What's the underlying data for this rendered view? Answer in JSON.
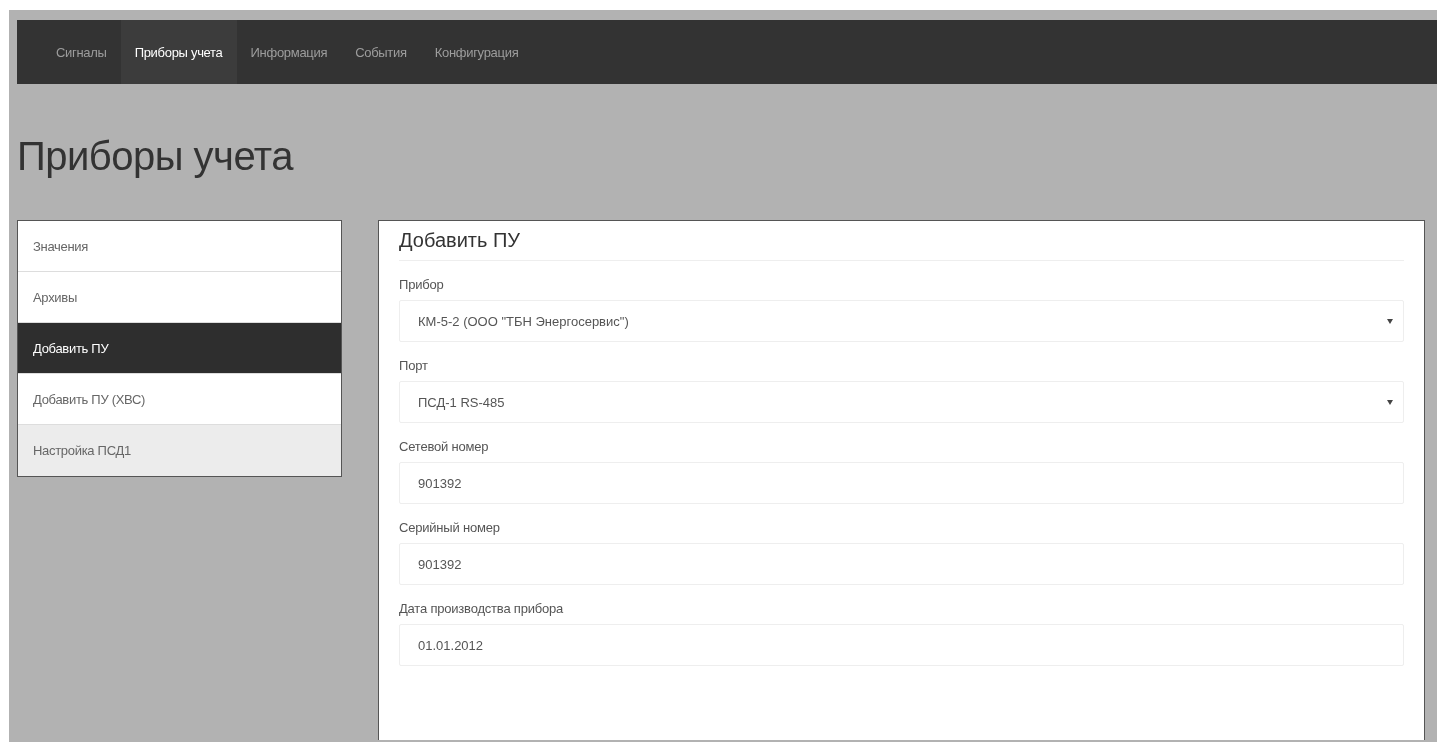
{
  "navbar": {
    "items": [
      {
        "label": "Сигналы",
        "selected": false
      },
      {
        "label": "Приборы учета",
        "selected": true
      },
      {
        "label": "Информация",
        "selected": false
      },
      {
        "label": "События",
        "selected": false
      },
      {
        "label": "Конфигурация",
        "selected": false
      }
    ]
  },
  "page_title": "Приборы учета",
  "sidebar": {
    "items": [
      {
        "label": "Значения",
        "selected": false,
        "highlighted": false
      },
      {
        "label": "Архивы",
        "selected": false,
        "highlighted": false
      },
      {
        "label": "Добавить ПУ",
        "selected": true,
        "highlighted": false
      },
      {
        "label": "Добавить ПУ (ХВС)",
        "selected": false,
        "highlighted": false
      },
      {
        "label": "Настройка ПСД1",
        "selected": false,
        "highlighted": true
      }
    ]
  },
  "form": {
    "title": "Добавить ПУ",
    "fields": [
      {
        "kind": "select",
        "label": "Прибор",
        "value": "КМ-5-2 (ООО \"ТБН Энергосервис\")"
      },
      {
        "kind": "select",
        "label": "Порт",
        "value": "ПСД-1 RS-485"
      },
      {
        "kind": "input",
        "label": "Сетевой номер",
        "value": "901392"
      },
      {
        "kind": "input",
        "label": "Серийный номер",
        "value": "901392"
      },
      {
        "kind": "input",
        "label": "Дата производства прибора",
        "value": "01.01.2012"
      }
    ]
  }
}
